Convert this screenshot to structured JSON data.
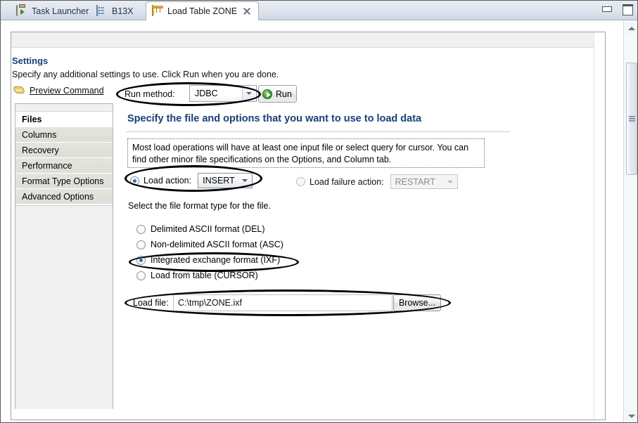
{
  "window": {
    "minimize_label": "Minimize",
    "maximize_label": "Maximize"
  },
  "tabs": [
    {
      "label": "Task Launcher",
      "icon": "clipboard-icon",
      "active": false,
      "closable": false
    },
    {
      "label": "B13X",
      "icon": "document-list-icon",
      "active": false,
      "closable": false
    },
    {
      "label": "Load Table ZONE",
      "icon": "table-icon",
      "active": true,
      "closable": true
    }
  ],
  "settings": {
    "title": "Settings",
    "subtitle": "Specify any additional settings to use. Click Run when you are done.",
    "preview_command_label": "Preview Command",
    "preview_icon": "flag-icon",
    "run_method_label": "Run method:",
    "run_method_value": "JDBC",
    "run_method_options": [
      "JDBC"
    ],
    "run_button_label": "Run",
    "run_button_icon": "play-icon"
  },
  "sidebar": {
    "items": [
      {
        "label": "Files",
        "selected": true
      },
      {
        "label": "Columns",
        "selected": false
      },
      {
        "label": "Recovery",
        "selected": false
      },
      {
        "label": "Performance",
        "selected": false
      },
      {
        "label": "Format Type Options",
        "selected": false
      },
      {
        "label": "Advanced Options",
        "selected": false
      }
    ]
  },
  "content": {
    "heading": "Specify the file and options that you want to use to load data",
    "info_text": "Most load operations will have at least one input file or select query for cursor. You can find other minor file specifications on the Options, and Column tab.",
    "load_action": {
      "label": "Load action:",
      "selected": true,
      "value": "INSERT",
      "options": [
        "INSERT"
      ]
    },
    "load_failure_action": {
      "label": "Load failure action:",
      "selected": false,
      "enabled": false,
      "value": "RESTART",
      "options": [
        "RESTART"
      ]
    },
    "format_hint": "Select the file format type for the file.",
    "format_options": [
      {
        "label": "Delimited ASCII format (DEL)",
        "selected": false
      },
      {
        "label": "Non-delimited ASCII format (ASC)",
        "selected": false
      },
      {
        "label": "Integrated exchange format (IXF)",
        "selected": true
      },
      {
        "label": "Load from table (CURSOR)",
        "selected": false
      }
    ],
    "load_file": {
      "label": "Load file:",
      "value": "C:\\tmp\\ZONE.ixf",
      "placeholder": "",
      "browse_label": "Browse..."
    }
  },
  "scrollbars": {
    "outer_up_icon": "scroll-up-arrow-icon",
    "outer_down_icon": "scroll-down-arrow-icon"
  },
  "colors": {
    "heading_blue": "#13427f",
    "annotation_black": "#000000",
    "radio_blue": "#2a6fc4",
    "run_green": "#2d8a22"
  }
}
